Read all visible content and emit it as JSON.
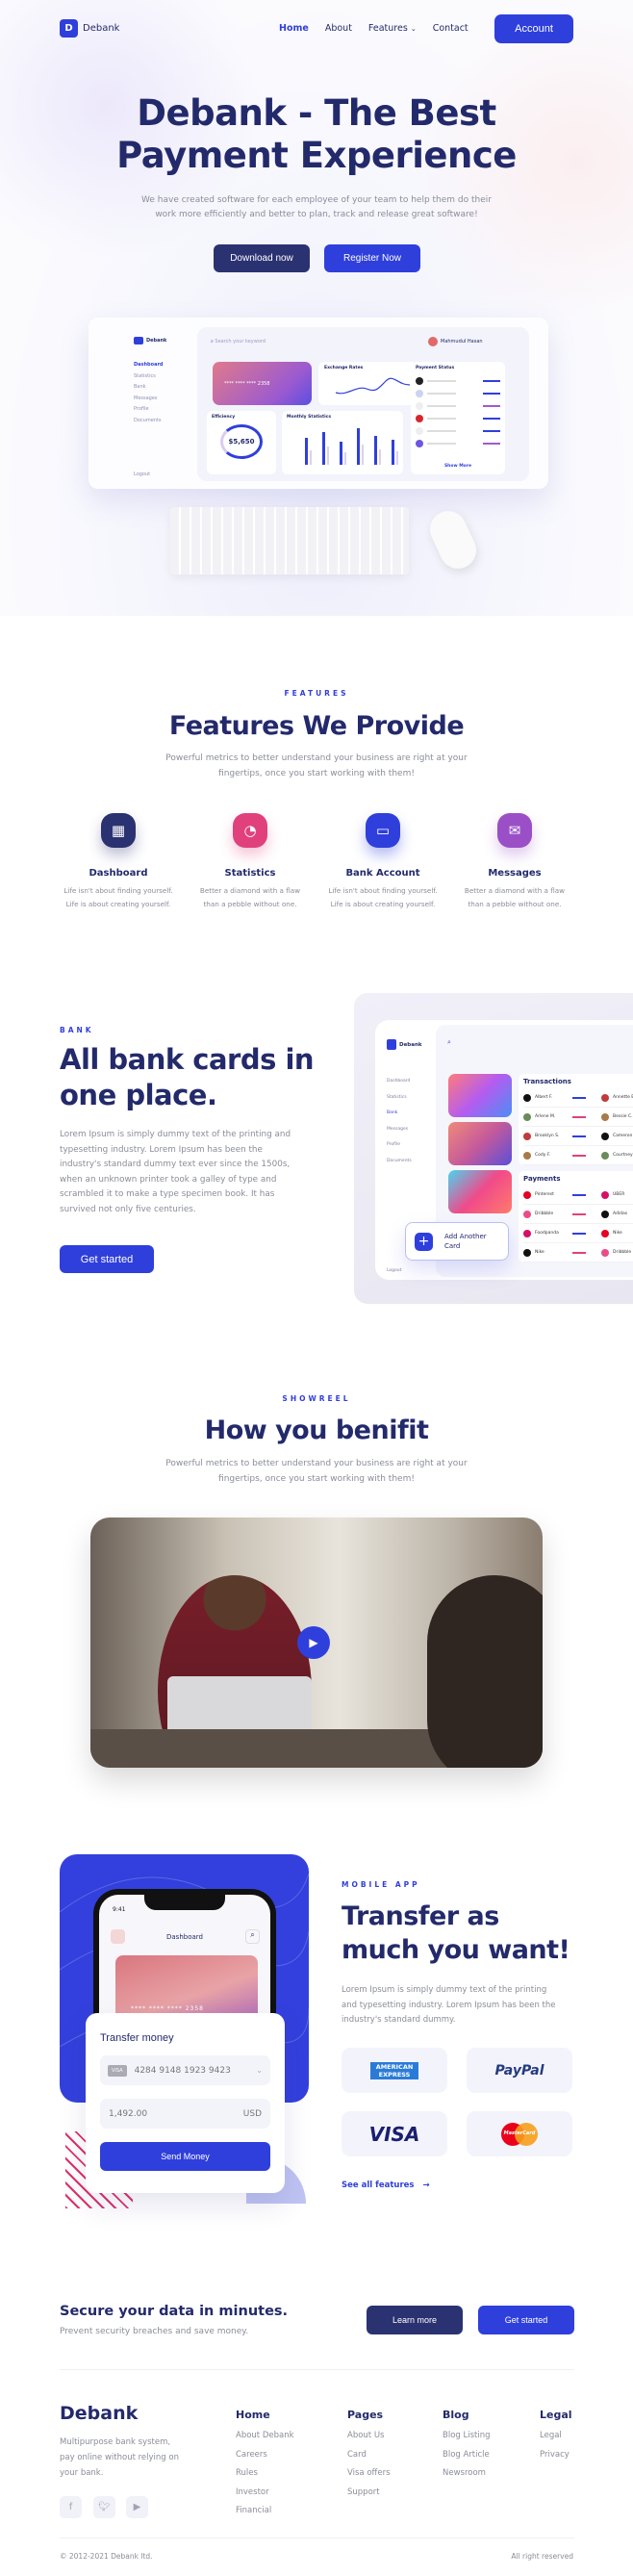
{
  "nav": {
    "brand": "Debank",
    "items": [
      "Home",
      "About",
      "Features",
      "Contact"
    ],
    "active": "Home",
    "account": "Account"
  },
  "hero": {
    "title_line1": "Debank - The Best",
    "title_line2": "Payment Experience",
    "subtitle_line1": "We have created software for each employee of your team to help them do their",
    "subtitle_line2": "work more efficiently and better to plan, track and release great software!",
    "download": "Download now",
    "register": "Register Now",
    "mockup": {
      "brand": "Debank",
      "menu": [
        "Dashboard",
        "Statistics",
        "Bank",
        "Messages",
        "Profile",
        "Documents"
      ],
      "logout": "Logout",
      "search_placeholder": "Search your keyword",
      "user": "Mahmudul Hasan",
      "balance": "$5,650",
      "card_number": "**** **** **** 2358",
      "exchange": "Exchange Rates",
      "efficiency": "Efficiency",
      "monthly": "Monthly Statistics",
      "payment_status": "Payment Status",
      "show_more": "Show More",
      "bars": [
        70,
        85,
        60,
        95,
        75,
        65
      ]
    }
  },
  "features": {
    "label": "FEATURES",
    "title": "Features We Provide",
    "subtitle_line1": "Powerful metrics to better understand your business are right at your",
    "subtitle_line2": "fingertips, once you start working with them!",
    "items": [
      {
        "title": "Dashboard",
        "d1": "Life isn't about finding yourself.",
        "d2": "Life is about creating yourself.",
        "icon": "dashboard-icon",
        "color": "#2b3272"
      },
      {
        "title": "Statistics",
        "d1": "Better a diamond with a flaw",
        "d2": "than a pebble without one.",
        "icon": "pie-chart-icon",
        "color": "#e0417c"
      },
      {
        "title": "Bank Account",
        "d1": "Life isn't about finding yourself.",
        "d2": "Life is about creating yourself.",
        "icon": "credit-card-icon",
        "color": "#2f3fdc"
      },
      {
        "title": "Messages",
        "d1": "Better a diamond with a flaw",
        "d2": "than a pebble without one.",
        "icon": "mail-icon",
        "color": "#9a4fc7"
      }
    ]
  },
  "bank": {
    "label": "BANK",
    "title_line1": "All bank cards in",
    "title_line2": "one place.",
    "paragraph": [
      "Lorem Ipsum is simply dummy text of the printing and",
      "typesetting industry. Lorem Ipsum has been the",
      "industry's standard dummy text ever since the 1500s,",
      "when an unknown printer took a galley of type and",
      "scrambled it to make a type specimen book. It has",
      "survived not only five centuries."
    ],
    "cta": "Get started",
    "mockup": {
      "brand": "Debank",
      "menu": [
        "Dashboard",
        "Statistics",
        "Bank",
        "Messages",
        "Profile",
        "Documents"
      ],
      "logout": "Logout",
      "transactions": "Transactions",
      "payments": "Payments",
      "people": [
        "Albert F.",
        "Arlene M.",
        "Brooklyn S.",
        "Cody F."
      ],
      "people2": [
        "Annette B.",
        "Bessie C.",
        "Cameron W.",
        "Courtney H."
      ],
      "merchants": [
        "Pinterest",
        "Dribbble",
        "Foodpanda",
        "Nike"
      ],
      "merchants2": [
        "UBER",
        "Adidas",
        "Nike",
        "Dribbble"
      ],
      "add_card": "Add Another Card"
    }
  },
  "showreel": {
    "label": "SHOWREEL",
    "title": "How you benifit",
    "subtitle_line1": "Powerful metrics to better understand your business are right at your",
    "subtitle_line2": "fingertips, once you start working with them!"
  },
  "mobile": {
    "label": "MOBILE APP",
    "title_line1": "Transfer as",
    "title_line2": "much you want!",
    "paragraph": [
      "Lorem Ipsum is simply dummy text of the printing",
      "and typesetting industry. Lorem Ipsum has been the",
      "industry's standard dummy."
    ],
    "see_all": "See all features",
    "phone": {
      "time": "9:41",
      "title": "Dashboard",
      "card_number": "**** **** **** 2358"
    },
    "transfer": {
      "title": "Transfer money",
      "card_brand": "VISA",
      "card_number": "4284 9148 1923 9423",
      "amount": "1,492.00",
      "currency": "USD",
      "send": "Send Money"
    },
    "logos": [
      "AMERICAN EXPRESS",
      "PayPal",
      "VISA",
      "MasterCard"
    ]
  },
  "cta": {
    "title": "Secure your data in minutes.",
    "subtitle": "Prevent security breaches and save money.",
    "learn": "Learn more",
    "start": "Get started"
  },
  "footer": {
    "brand": "Debank",
    "desc": [
      "Multipurpose bank system,",
      "pay online without relying on",
      "your bank."
    ],
    "columns": [
      {
        "title": "Home",
        "items": [
          "About Debank",
          "Careers",
          "Rules",
          "Investor",
          "Financial"
        ]
      },
      {
        "title": "Pages",
        "items": [
          "About Us",
          "Card",
          "Visa offers",
          "Support"
        ]
      },
      {
        "title": "Blog",
        "items": [
          "Blog Listing",
          "Blog Article",
          "Newsroom"
        ]
      },
      {
        "title": "Legal",
        "items": [
          "Legal",
          "Privacy"
        ]
      }
    ],
    "copyright": "© 2012-2021 Debank ltd.",
    "rights": "All right reserved"
  }
}
